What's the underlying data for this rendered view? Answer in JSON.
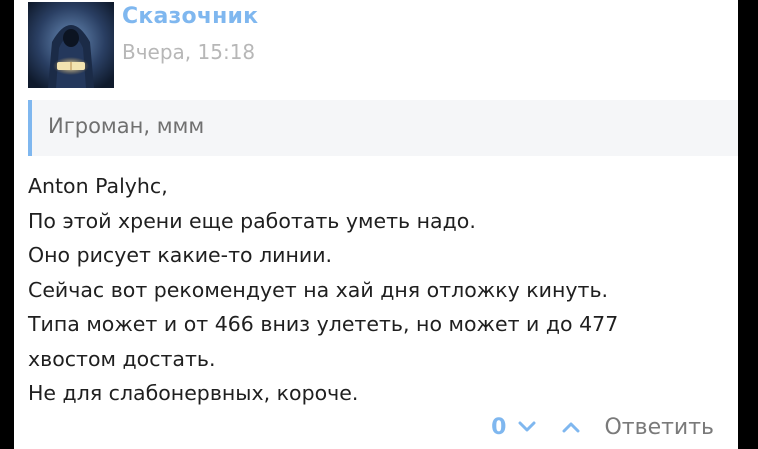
{
  "post": {
    "author": "Сказочник",
    "timestamp": "Вчера, 15:18",
    "quote": "Игроман, ммм",
    "lines": [
      "Anton Palyhc,",
      "По этой хрени еще работать уметь надо.",
      "Оно рисует какие-то линии.",
      "Сейчас вот рекомендует на хай дня отложку кинуть.",
      "Типа может и от 466 вниз улететь, но может и до 477",
      "хвостом достать.",
      "Не для слабонервных, короче."
    ]
  },
  "footer": {
    "vote_count": "0",
    "reply_label": "Ответить"
  },
  "icons": {
    "downvote": "chevron-down-icon",
    "upvote": "chevron-up-icon"
  },
  "colors": {
    "accent": "#7fb7ef",
    "text": "#1f1f1f",
    "muted": "#b7b7b7",
    "quote_bg": "#f5f6f8"
  }
}
